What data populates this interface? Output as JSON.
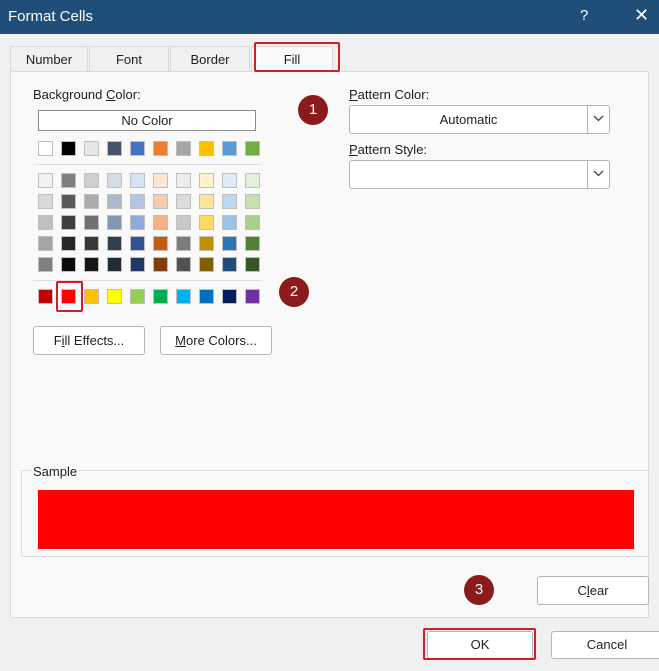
{
  "window": {
    "title": "Format Cells",
    "help": "?",
    "close": "✕"
  },
  "tabs": [
    {
      "label": "Number"
    },
    {
      "label": "Font"
    },
    {
      "label": "Border"
    },
    {
      "label": "Fill"
    }
  ],
  "fill": {
    "background_label_pre": "Background ",
    "background_label_key": "C",
    "background_label_post": "olor:",
    "no_color": "No Color",
    "pattern_color_key": "P",
    "pattern_color_rest": "attern Color:",
    "pattern_color_value": "Automatic",
    "pattern_style_key": "P",
    "pattern_style_rest": "attern Style:",
    "pattern_style_value": "",
    "fill_effects_pre": "F",
    "fill_effects_key": "i",
    "fill_effects_post": "ll Effects...",
    "more_colors_key": "M",
    "more_colors_rest": "ore Colors...",
    "sample_label": "Sample",
    "sample_color": "#ff0000",
    "selected_color": "#ff0000"
  },
  "palette": {
    "row1": [
      "#ffffff",
      "#000000",
      "#e7e6e6",
      "#44546a",
      "#4472c4",
      "#ed7d31",
      "#a5a5a5",
      "#ffc000",
      "#5b9bd5",
      "#70ad47"
    ],
    "shades": [
      [
        "#f2f2f2",
        "#7f7f7f",
        "#d0cece",
        "#d6dce4",
        "#d9e2f3",
        "#fbe5d5",
        "#ededed",
        "#fff2cc",
        "#deebf6",
        "#e2efd9"
      ],
      [
        "#d8d8d8",
        "#595959",
        "#aeabab",
        "#adb9ca",
        "#b4c6e7",
        "#f7cbac",
        "#dbdbdb",
        "#fee599",
        "#bdd7ee",
        "#c5e0b3"
      ],
      [
        "#bfbfbf",
        "#3f3f3f",
        "#757070",
        "#8496b0",
        "#8eaadb",
        "#f4b183",
        "#c9c9c9",
        "#ffd965",
        "#9cc3e5",
        "#a8d08d"
      ],
      [
        "#a5a5a5",
        "#262626",
        "#3a3838",
        "#323f4f",
        "#2f5496",
        "#c55a11",
        "#7b7b7b",
        "#bf9000",
        "#2e75b5",
        "#538135"
      ],
      [
        "#7f7f7f",
        "#0c0c0c",
        "#171616",
        "#222a35",
        "#1f3864",
        "#833c0b",
        "#525252",
        "#7f6000",
        "#1f4e79",
        "#375623"
      ]
    ],
    "standard": [
      "#c00000",
      "#ff0000",
      "#ffc000",
      "#ffff00",
      "#92d050",
      "#00b050",
      "#00b0f0",
      "#0070c0",
      "#002060",
      "#7030a0"
    ]
  },
  "buttons": {
    "clear_pre": "C",
    "clear_key": "l",
    "clear_post": "ear",
    "ok": "OK",
    "cancel": "Cancel"
  },
  "steps": [
    "1",
    "2",
    "3"
  ],
  "colors": {
    "titlebar": "#1f4e78",
    "highlight": "#d11f2a",
    "step": "#8b1a1a"
  }
}
